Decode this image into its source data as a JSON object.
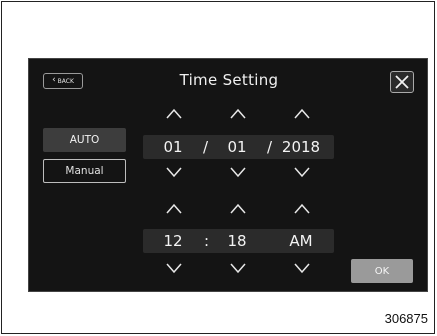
{
  "header": {
    "back_label": "BACK",
    "title": "Time Setting"
  },
  "mode": {
    "auto_label": "AUTO",
    "manual_label": "Manual"
  },
  "date": {
    "month": "01",
    "day": "01",
    "year": "2018",
    "separator": "/"
  },
  "time": {
    "hour": "12",
    "minute": "18",
    "period": "AM",
    "separator": ":"
  },
  "ok_label": "OK",
  "figure_number": "306875"
}
